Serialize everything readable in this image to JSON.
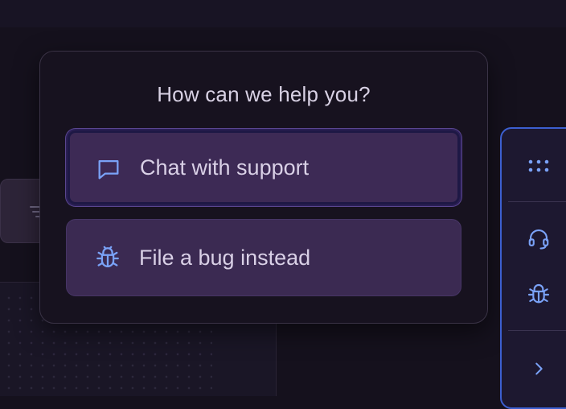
{
  "popover": {
    "title": "How can we help you?",
    "options": [
      {
        "label": "Chat with support",
        "icon": "chat-bubble-icon",
        "selected": true
      },
      {
        "label": "File a bug instead",
        "icon": "bug-icon",
        "selected": false
      }
    ]
  },
  "rail": {
    "items": [
      {
        "icon": "apps-grid-icon"
      },
      {
        "icon": "headset-icon"
      },
      {
        "icon": "bug-icon"
      },
      {
        "icon": "chevron-right-icon"
      }
    ]
  },
  "colors": {
    "accent_icon": "#7aa2f7",
    "option_bg": "#3b2a52",
    "rail_border": "#3c5fd0"
  }
}
